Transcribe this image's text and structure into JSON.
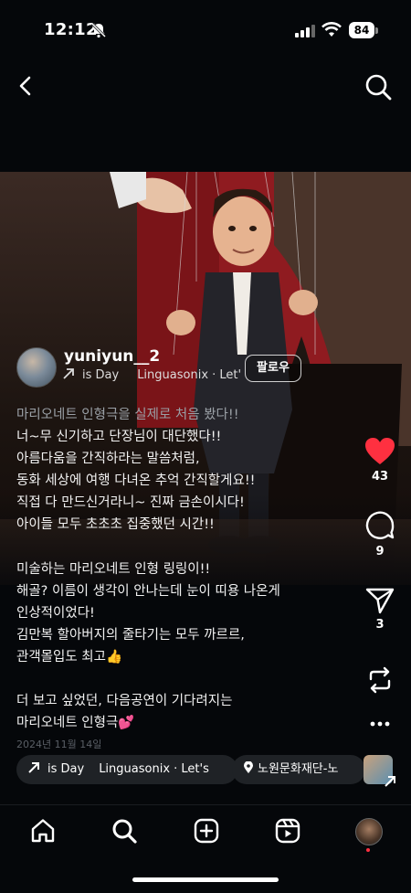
{
  "status": {
    "time": "12:12",
    "battery": "84"
  },
  "post": {
    "username": "yuniyun__2",
    "audio_chip_text": "is Day",
    "audio_artist_text": "Linguasonix · Let'",
    "follow_label": "팔로우",
    "caption_lines_1": [
      "마리오네트 인형극을 실제로 처음 봤다!!",
      "너~무 신기하고 단장님이 대단했다!!",
      "아름다움을 간직하라는 말씀처럼,",
      "동화 세상에 여행 다녀온 추억 간직할게요!!",
      "직접 다 만드신거라니~ 진짜 금손이시다!",
      "아이들 모두 초초초 집중했던 시간!!"
    ],
    "caption_lines_2": [
      "미술하는 마리오네트 인형 링링이!!",
      "해골? 이름이 생각이 안나는데 눈이 띠용 나온게",
      "인상적이었다!",
      "김만복 할아버지의 줄타기는 모두 까르르,",
      "관객몰입도 최고👍"
    ],
    "caption_lines_3": [
      "더 보고 싶었던, 다음공연이 기다려지는",
      "마리오네트 인형극💕"
    ],
    "date": "2024년 11월 14일"
  },
  "actions": {
    "likes": "43",
    "comments": "9",
    "shares": "3"
  },
  "chips": {
    "audio_text": "is Day",
    "audio_artist": "Linguasonix · Let's",
    "location": "노원문화재단-노"
  },
  "icons": [
    "back-icon",
    "search-icon",
    "heart-icon",
    "comment-icon",
    "share-icon",
    "remix-icon",
    "more-icon",
    "home-icon",
    "explore-icon",
    "create-icon",
    "reels-icon"
  ],
  "colors": {
    "like": "#ff3040",
    "background": "#05070a"
  }
}
